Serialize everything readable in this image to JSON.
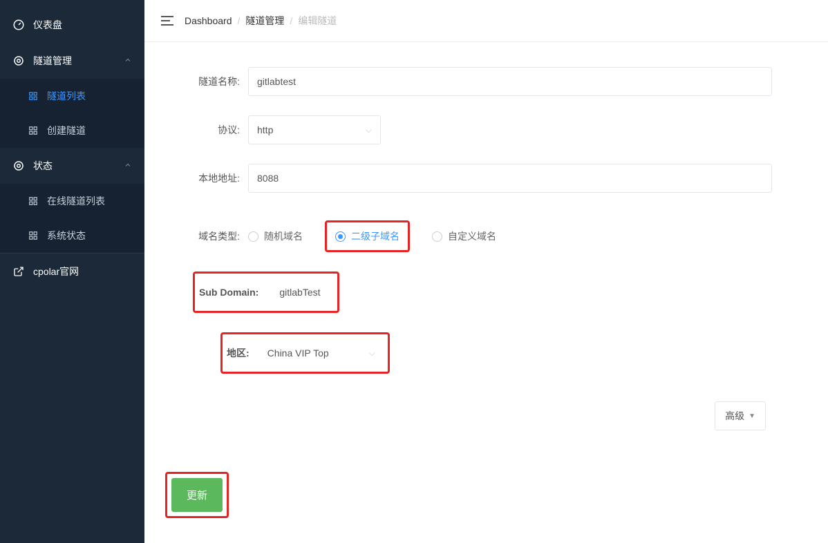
{
  "sidebar": {
    "dashboard": "仪表盘",
    "tunnel_mgmt": "隧道管理",
    "tunnel_list": "隧道列表",
    "create_tunnel": "创建隧道",
    "status": "状态",
    "online_tunnels": "在线隧道列表",
    "system_status": "系统状态",
    "cpolar": "cpolar官网"
  },
  "breadcrumb": {
    "dashboard": "Dashboard",
    "tunnel_mgmt": "隧道管理",
    "edit_tunnel": "编辑隧道"
  },
  "form": {
    "tunnel_name_label": "隧道名称:",
    "tunnel_name_value": "gitlabtest",
    "protocol_label": "协议:",
    "protocol_value": "http",
    "local_addr_label": "本地地址:",
    "local_addr_value": "8088",
    "domain_type_label": "域名类型:",
    "radio_random": "随机域名",
    "radio_subdomain": "二级子域名",
    "radio_custom": "自定义域名",
    "sub_domain_label": "Sub Domain:",
    "sub_domain_value": "gitlabTest",
    "region_label": "地区:",
    "region_value": "China VIP Top",
    "advanced_label": "高级",
    "update_label": "更新"
  }
}
